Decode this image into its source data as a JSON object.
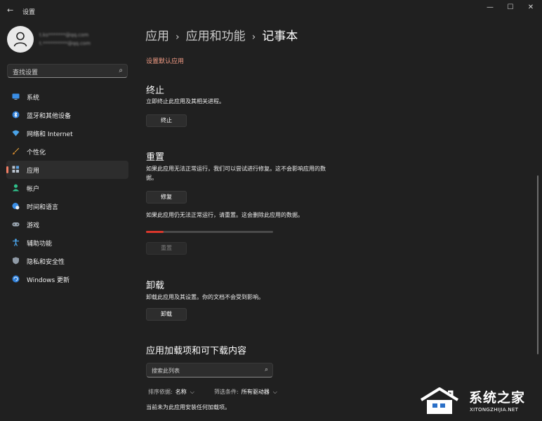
{
  "window": {
    "title": "设置",
    "back_icon": "back-arrow-icon",
    "minimize_icon": "minimize-icon",
    "maximize_icon": "maximize-icon",
    "close_icon": "close-icon"
  },
  "profile": {
    "account_line1": "t.ks*******@qq.com",
    "account_line2": "t.**********@qq.com"
  },
  "sidebar": {
    "search_placeholder": "查找设置",
    "items": [
      {
        "label": "系统",
        "icon": "monitor-icon",
        "active": false
      },
      {
        "label": "蓝牙和其他设备",
        "icon": "bluetooth-icon",
        "active": false
      },
      {
        "label": "网络和 Internet",
        "icon": "wifi-icon",
        "active": false
      },
      {
        "label": "个性化",
        "icon": "brush-icon",
        "active": false
      },
      {
        "label": "应用",
        "icon": "apps-icon",
        "active": true
      },
      {
        "label": "帐户",
        "icon": "person-icon",
        "active": false
      },
      {
        "label": "时间和语言",
        "icon": "globe-clock-icon",
        "active": false
      },
      {
        "label": "游戏",
        "icon": "gamepad-icon",
        "active": false
      },
      {
        "label": "辅助功能",
        "icon": "accessibility-icon",
        "active": false
      },
      {
        "label": "隐私和安全性",
        "icon": "shield-icon",
        "active": false
      },
      {
        "label": "Windows 更新",
        "icon": "update-icon",
        "active": false
      }
    ]
  },
  "breadcrumb": {
    "part1": "应用",
    "part2": "应用和功能",
    "current": "记事本",
    "separator": "›"
  },
  "main": {
    "default_apps_link": "设置默认应用",
    "terminate": {
      "heading": "终止",
      "description": "立即终止此应用及其相关进程。",
      "button": "终止"
    },
    "reset": {
      "heading": "重置",
      "repair_description_line1": "如果此应用无法正常运行，我们可以尝试进行修复。这不会影响应用的数",
      "repair_description_line2": "据。",
      "repair_button": "修复",
      "reset_description": "如果此应用仍无法正常运行，请重置。这会删除此应用的数据。",
      "progress_fraction": 0.14,
      "reset_button": "重置"
    },
    "uninstall": {
      "heading": "卸载",
      "description": "卸载此应用及其设置。你的文档不会受到影响。",
      "button": "卸载"
    },
    "addons": {
      "heading": "应用加载项和可下载内容",
      "search_placeholder": "搜索此列表",
      "sort_label": "排序依据:",
      "sort_value": "名称",
      "filter_label": "筛选条件:",
      "filter_value": "所有驱动器",
      "empty_message": "当前未为此应用安装任何加载项。"
    }
  },
  "watermark": {
    "text": "系统之家",
    "url": "XITONGZHIJIA.NET"
  },
  "colors": {
    "background": "#202020",
    "accent": "#f07e64",
    "link": "#f19b84",
    "progress": "#d9372c"
  }
}
